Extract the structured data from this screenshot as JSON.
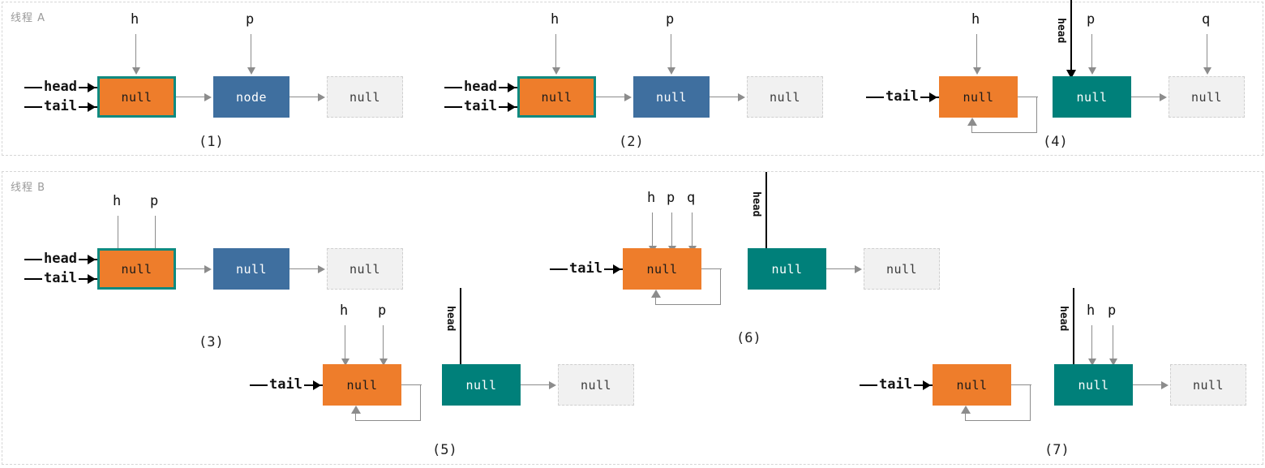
{
  "diagram": {
    "title_lanes": [
      {
        "id": "lane-a",
        "label": "线程 A"
      },
      {
        "id": "lane-b",
        "label": "线程 B"
      }
    ],
    "colors": {
      "orange": "#ee7d2b",
      "blue": "#3f6f9f",
      "teal": "#00807a",
      "ghost": "#f1f1f1",
      "highlight_border": "#0e8a80",
      "arrow_gray": "#8c8c8c",
      "arrow_black": "#000000",
      "panel_border": "#d6d6d6",
      "lane_label": "#9a9a9a"
    },
    "node_values": {
      "null": "null",
      "node": "node"
    },
    "pointers": {
      "head": "head",
      "tail": "tail",
      "h": "h",
      "p": "p",
      "q": "q"
    },
    "captions": {
      "s1": "(1)",
      "s2": "(2)",
      "s3": "(3)",
      "s4": "(4)",
      "s5": "(5)",
      "s6": "(6)",
      "s7": "(7)"
    },
    "steps": [
      {
        "caption": "(1)",
        "lane": "线程 A",
        "incoming_pointers": [
          "head",
          "tail"
        ],
        "top_pointers": [
          "h",
          "p"
        ],
        "nodes": [
          {
            "value": "null",
            "style": "orange-highlighted"
          },
          {
            "value": "node",
            "style": "blue"
          },
          {
            "value": "null",
            "style": "ghost"
          }
        ],
        "self_loop": false,
        "head_vertical_arrow": false
      },
      {
        "caption": "(2)",
        "lane": "线程 A",
        "incoming_pointers": [
          "head",
          "tail"
        ],
        "top_pointers": [
          "h",
          "p"
        ],
        "nodes": [
          {
            "value": "null",
            "style": "orange-highlighted"
          },
          {
            "value": "null",
            "style": "blue"
          },
          {
            "value": "null",
            "style": "ghost"
          }
        ],
        "self_loop": false,
        "head_vertical_arrow": false
      },
      {
        "caption": "(3)",
        "lane": "线程 B",
        "incoming_pointers": [
          "head",
          "tail"
        ],
        "top_pointers": [
          "h",
          "p"
        ],
        "nodes": [
          {
            "value": "null",
            "style": "orange-highlighted"
          },
          {
            "value": "null",
            "style": "blue"
          },
          {
            "value": "null",
            "style": "ghost"
          }
        ],
        "self_loop": false,
        "head_vertical_arrow": false
      },
      {
        "caption": "(4)",
        "lane": "线程 A",
        "incoming_pointers": [
          "tail"
        ],
        "top_pointers": [
          "h",
          "p",
          "q"
        ],
        "nodes": [
          {
            "value": "null",
            "style": "orange"
          },
          {
            "value": "null",
            "style": "teal"
          },
          {
            "value": "null",
            "style": "ghost"
          }
        ],
        "self_loop": true,
        "head_vertical_arrow": true
      },
      {
        "caption": "(5)",
        "lane": "线程 B",
        "incoming_pointers": [
          "tail"
        ],
        "top_pointers": [
          "h",
          "p"
        ],
        "nodes": [
          {
            "value": "null",
            "style": "orange"
          },
          {
            "value": "null",
            "style": "teal"
          },
          {
            "value": "null",
            "style": "ghost"
          }
        ],
        "self_loop": true,
        "head_vertical_arrow": true
      },
      {
        "caption": "(6)",
        "lane": "线程 B",
        "incoming_pointers": [
          "tail"
        ],
        "top_pointers": [
          "h",
          "p",
          "q"
        ],
        "nodes": [
          {
            "value": "null",
            "style": "orange"
          },
          {
            "value": "null",
            "style": "teal"
          },
          {
            "value": "null",
            "style": "ghost"
          }
        ],
        "self_loop": true,
        "head_vertical_arrow": true
      },
      {
        "caption": "(7)",
        "lane": "线程 B",
        "incoming_pointers": [
          "tail"
        ],
        "top_pointers": [
          "h",
          "p"
        ],
        "nodes": [
          {
            "value": "null",
            "style": "orange"
          },
          {
            "value": "null",
            "style": "teal"
          },
          {
            "value": "null",
            "style": "ghost"
          }
        ],
        "self_loop": true,
        "head_vertical_arrow": true
      }
    ]
  }
}
